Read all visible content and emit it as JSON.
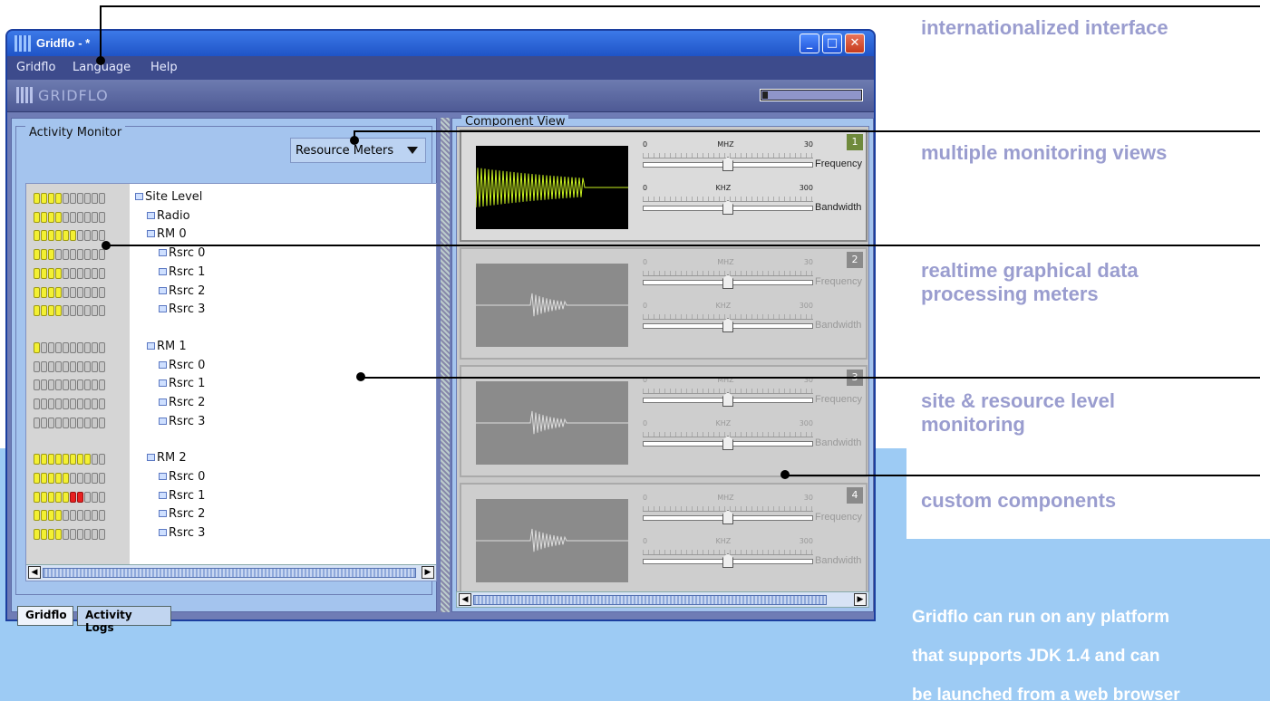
{
  "window": {
    "title": "Gridflo - *",
    "menu": [
      "Gridflo",
      "Language",
      "Help"
    ],
    "brand": "GRIDFLO",
    "progress": 0.05
  },
  "activity_monitor": {
    "title": "Activity Monitor",
    "view_select": "Resource Meters",
    "tree": [
      {
        "label": "Site Level",
        "leds": 10,
        "lit": 4,
        "red": 0
      },
      {
        "label": "Radio",
        "leds": 10,
        "lit": 4,
        "red": 0
      },
      {
        "label": "RM 0",
        "leds": 10,
        "lit": 6,
        "red": 0
      },
      {
        "label": "Rsrc 0",
        "leds": 10,
        "lit": 3,
        "red": 0
      },
      {
        "label": "Rsrc 1",
        "leds": 10,
        "lit": 4,
        "red": 0
      },
      {
        "label": "Rsrc 2",
        "leds": 10,
        "lit": 4,
        "red": 0
      },
      {
        "label": "Rsrc 3",
        "leds": 10,
        "lit": 4,
        "red": 0
      },
      {
        "label": "RM 1",
        "leds": 10,
        "lit": 1,
        "red": 0
      },
      {
        "label": "Rsrc 0",
        "leds": 10,
        "lit": 0,
        "red": 0
      },
      {
        "label": "Rsrc 1",
        "leds": 10,
        "lit": 0,
        "red": 0
      },
      {
        "label": "Rsrc 2",
        "leds": 10,
        "lit": 0,
        "red": 0
      },
      {
        "label": "Rsrc 3",
        "leds": 10,
        "lit": 0,
        "red": 0
      },
      {
        "label": "RM 2",
        "leds": 10,
        "lit": 8,
        "red": 0
      },
      {
        "label": "Rsrc 0",
        "leds": 10,
        "lit": 5,
        "red": 0
      },
      {
        "label": "Rsrc 1",
        "leds": 10,
        "lit": 7,
        "red": 2
      },
      {
        "label": "Rsrc 2",
        "leds": 10,
        "lit": 4,
        "red": 0
      },
      {
        "label": "Rsrc 3",
        "leds": 10,
        "lit": 4,
        "red": 0
      }
    ],
    "tabs": [
      "Gridflo",
      "Activity Logs"
    ]
  },
  "component_view": {
    "title": "Component View",
    "components": [
      {
        "num": "1",
        "active": true,
        "freq_scale": [
          "0",
          "MHZ",
          "30"
        ],
        "bw_scale": [
          "0",
          "KHZ",
          "300"
        ],
        "freq_label": "Frequency",
        "bw_label": "Bandwidth",
        "freq_value": 0.5,
        "bw_value": 0.5
      },
      {
        "num": "2",
        "active": false,
        "freq_scale": [
          "0",
          "MHZ",
          "30"
        ],
        "bw_scale": [
          "0",
          "KHZ",
          "300"
        ],
        "freq_label": "Frequency",
        "bw_label": "Bandwidth",
        "freq_value": 0.5,
        "bw_value": 0.5
      },
      {
        "num": "3",
        "active": false,
        "freq_scale": [
          "0",
          "MHZ",
          "30"
        ],
        "bw_scale": [
          "0",
          "KHZ",
          "300"
        ],
        "freq_label": "Frequency",
        "bw_label": "Bandwidth",
        "freq_value": 0.5,
        "bw_value": 0.5
      },
      {
        "num": "4",
        "active": false,
        "freq_scale": [
          "0",
          "MHZ",
          "30"
        ],
        "bw_scale": [
          "0",
          "KHZ",
          "300"
        ],
        "freq_label": "Frequency",
        "bw_label": "Bandwidth",
        "freq_value": 0.5,
        "bw_value": 0.5
      }
    ]
  },
  "callouts": [
    "internationalized interface",
    "multiple monitoring views",
    "realtime graphical data processing meters",
    "site & resource level monitoring",
    "custom components"
  ],
  "promo": [
    "Gridflo can run on any platform",
    "that supports JDK 1.4 and can",
    "be launched from a web browser"
  ],
  "colors": {
    "accent": "#9a9dcf",
    "led_on": "#f3f032",
    "led_alert": "#e82020",
    "promo_bg": "#9dcbf4"
  }
}
